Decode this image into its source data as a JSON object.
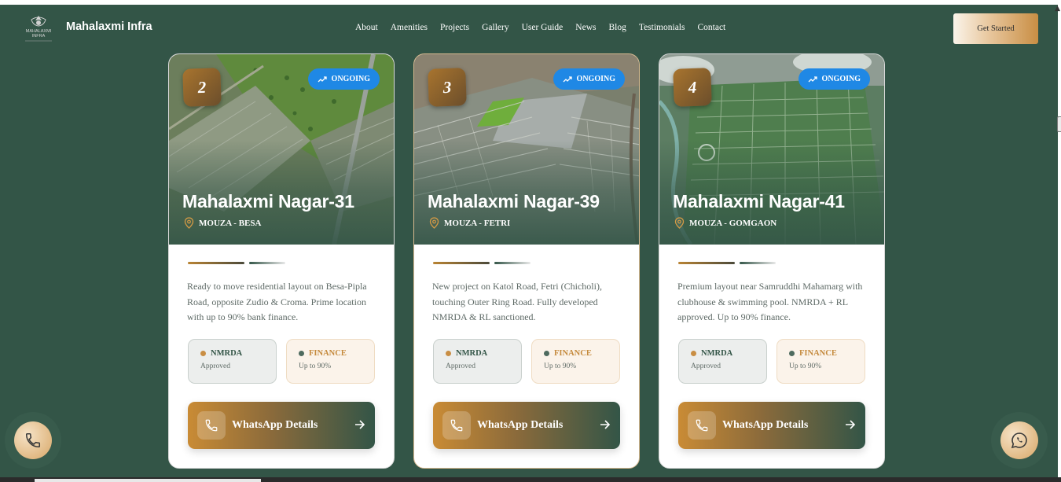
{
  "header": {
    "brand": "Mahalaxmi Infra",
    "logo_text": "MAHALAXMI INFRA",
    "nav": [
      "About",
      "Amenities",
      "Projects",
      "Gallery",
      "User Guide",
      "News",
      "Blog",
      "Testimonials",
      "Contact"
    ],
    "cta": "Get Started"
  },
  "cards": [
    {
      "number": "2",
      "status": "ONGOING",
      "title": "Mahalaxmi Nagar-31",
      "location": "MOUZA - BESA",
      "description": "Ready to move residential layout on Besa-Pipla Road, opposite Zudio & Croma. Prime location with up to 90% bank finance.",
      "chip1_title": "NMRDA",
      "chip1_sub": "Approved",
      "chip2_title": "FINANCE",
      "chip2_sub": "Up to 90%",
      "button": "WhatsApp Details"
    },
    {
      "number": "3",
      "status": "ONGOING",
      "title": "Mahalaxmi Nagar-39",
      "location": "MOUZA - FETRI",
      "description": "New project on Katol Road, Fetri (Chicholi), touching Outer Ring Road. Fully developed NMRDA & RL sanctioned.",
      "chip1_title": "NMRDA",
      "chip1_sub": "Approved",
      "chip2_title": "FINANCE",
      "chip2_sub": "Up to 90%",
      "button": "WhatsApp Details"
    },
    {
      "number": "4",
      "status": "ONGOING",
      "title": "Mahalaxmi Nagar-41",
      "location": "MOUZA - GOMGAON",
      "description": "Premium layout near Samruddhi Mahamarg with clubhouse & swimming pool. NMRDA + RL approved. Up to 90% finance.",
      "chip1_title": "NMRDA",
      "chip1_sub": "Approved",
      "chip2_title": "FINANCE",
      "chip2_sub": "Up to 90%",
      "button": "WhatsApp Details"
    }
  ],
  "colors": {
    "background": "#335547",
    "accent_gold": "#c98e44",
    "badge_blue": "#1f88e5"
  },
  "icons": {
    "floating_left": "phone-icon",
    "floating_right": "whatsapp-icon"
  }
}
